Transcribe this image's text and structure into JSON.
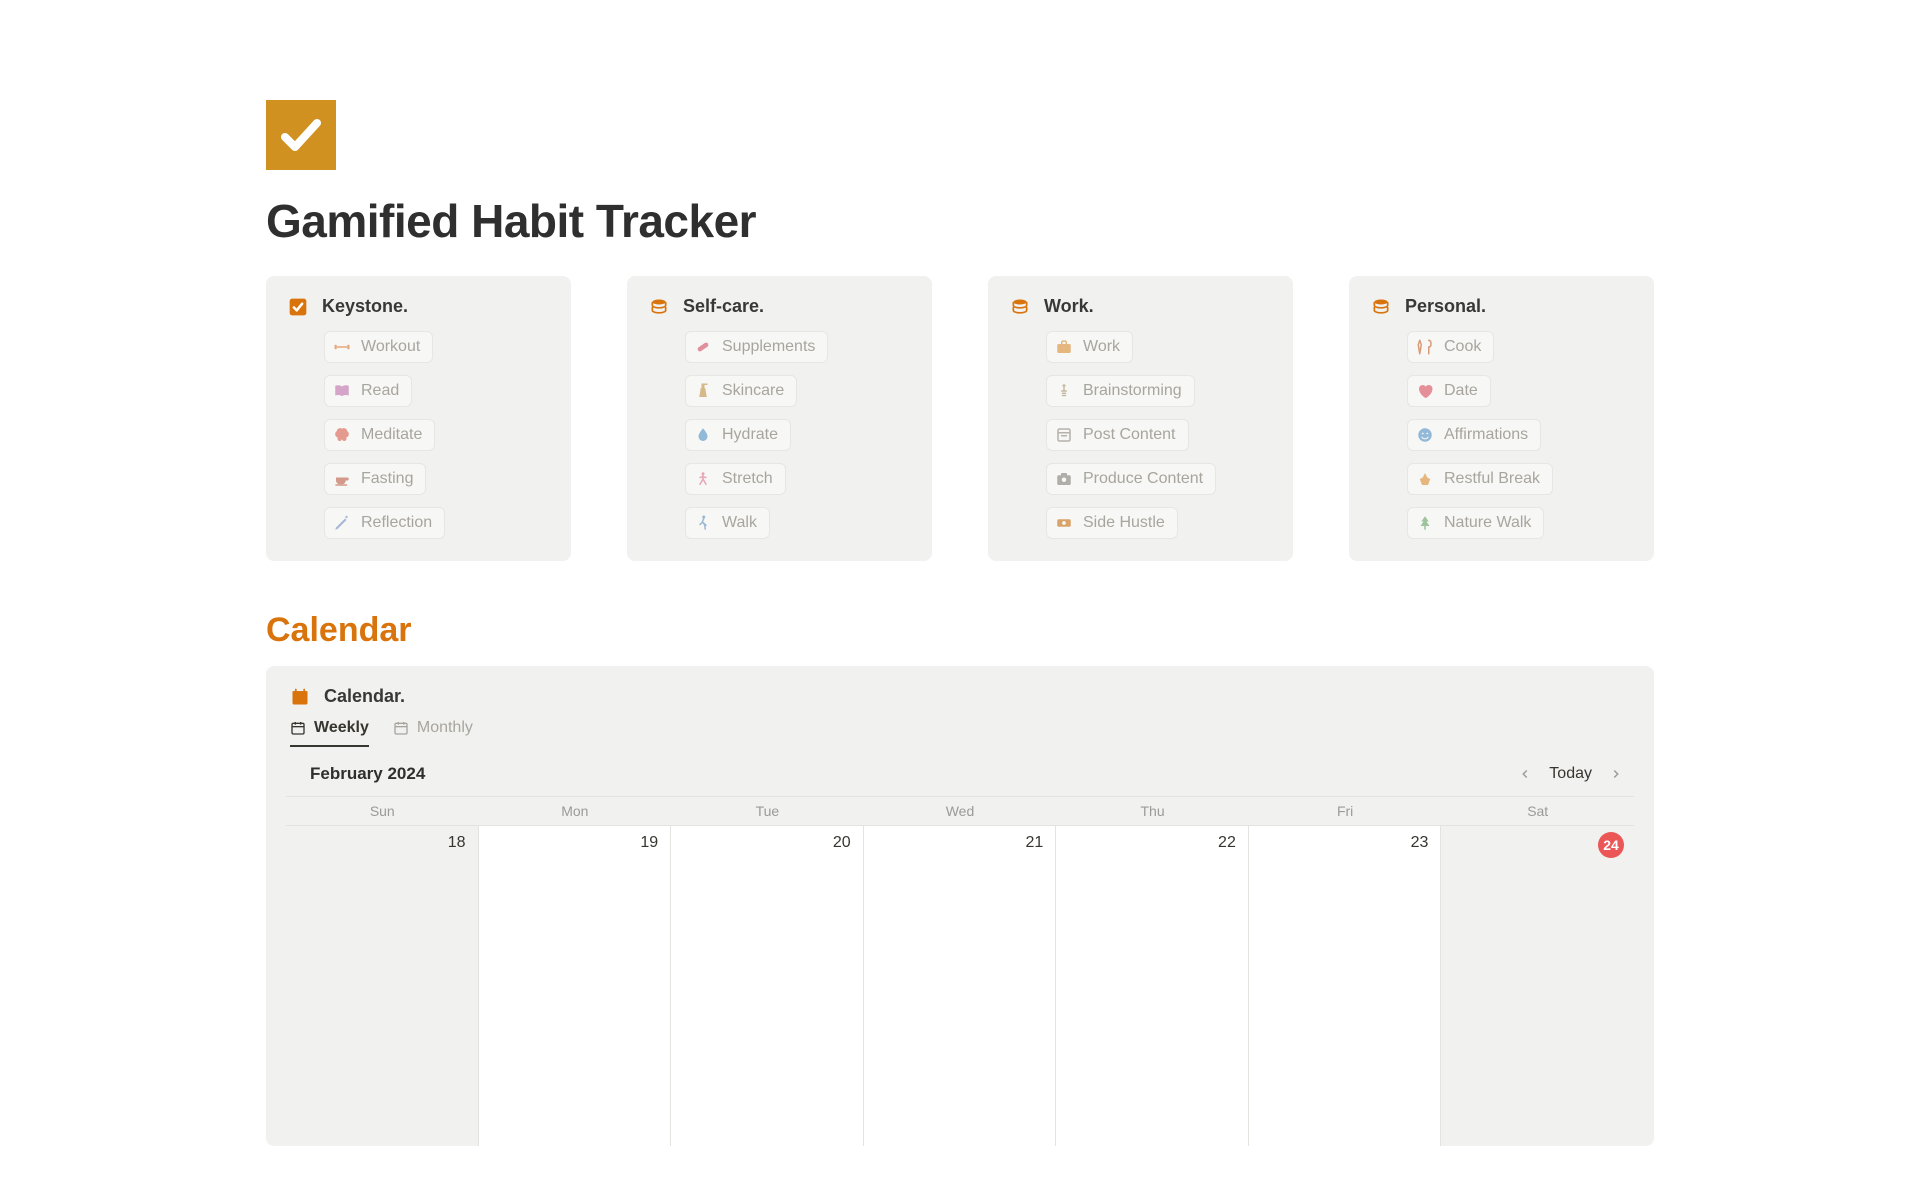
{
  "page": {
    "title": "Gamified Habit Tracker"
  },
  "cards": [
    {
      "icon": "checkbox-icon",
      "icon_color": "#d9740d",
      "title": "Keystone.",
      "items": [
        {
          "icon": "dumbbell-icon",
          "icon_color": "#e8a87c",
          "label": "Workout"
        },
        {
          "icon": "book-icon",
          "icon_color": "#d4a5c9",
          "label": "Read"
        },
        {
          "icon": "brain-icon",
          "icon_color": "#e59a8f",
          "label": "Meditate"
        },
        {
          "icon": "coffee-icon",
          "icon_color": "#d39a8a",
          "label": "Fasting"
        },
        {
          "icon": "pencil-icon",
          "icon_color": "#a7b7d6",
          "label": "Reflection"
        }
      ]
    },
    {
      "icon": "stack-icon",
      "icon_color": "#d9740d",
      "title": "Self-care.",
      "items": [
        {
          "icon": "pill-icon",
          "icon_color": "#e08f9b",
          "label": "Supplements"
        },
        {
          "icon": "lotion-icon",
          "icon_color": "#d6b98a",
          "label": "Skincare"
        },
        {
          "icon": "droplet-icon",
          "icon_color": "#93b9d9",
          "label": "Hydrate"
        },
        {
          "icon": "stretch-icon",
          "icon_color": "#e7a6b3",
          "label": "Stretch"
        },
        {
          "icon": "walk-icon",
          "icon_color": "#9bb7d4",
          "label": "Walk"
        }
      ]
    },
    {
      "icon": "stack-icon",
      "icon_color": "#d9740d",
      "title": "Work.",
      "items": [
        {
          "icon": "briefcase-icon",
          "icon_color": "#e5b77e",
          "label": "Work"
        },
        {
          "icon": "lightbulb-icon",
          "icon_color": "#c7b9a3",
          "label": "Brainstorming"
        },
        {
          "icon": "post-icon",
          "icon_color": "#b5b2ac",
          "label": "Post Content"
        },
        {
          "icon": "camera-icon",
          "icon_color": "#b0aea8",
          "label": "Produce Content"
        },
        {
          "icon": "money-icon",
          "icon_color": "#d9a36a",
          "label": "Side Hustle"
        }
      ]
    },
    {
      "icon": "stack-icon",
      "icon_color": "#d9740d",
      "title": "Personal.",
      "items": [
        {
          "icon": "utensil-icon",
          "icon_color": "#d99a7a",
          "label": "Cook"
        },
        {
          "icon": "heart-icon",
          "icon_color": "#e58f98",
          "label": "Date"
        },
        {
          "icon": "smile-icon",
          "icon_color": "#93b9d9",
          "label": "Affirmations"
        },
        {
          "icon": "praise-icon",
          "icon_color": "#e5b77e",
          "label": "Restful Break"
        },
        {
          "icon": "tree-icon",
          "icon_color": "#9ec49e",
          "label": "Nature Walk"
        }
      ]
    }
  ],
  "calendar_section_heading": "Calendar",
  "calendar": {
    "title": "Calendar.",
    "tabs": [
      {
        "label": "Weekly",
        "active": true
      },
      {
        "label": "Monthly",
        "active": false
      }
    ],
    "month_label": "February 2024",
    "today_label": "Today",
    "day_headers": [
      "Sun",
      "Mon",
      "Tue",
      "Wed",
      "Thu",
      "Fri",
      "Sat"
    ],
    "dates": [
      {
        "num": "18",
        "today": false
      },
      {
        "num": "19",
        "today": false
      },
      {
        "num": "20",
        "today": false
      },
      {
        "num": "21",
        "today": false
      },
      {
        "num": "22",
        "today": false
      },
      {
        "num": "23",
        "today": false
      },
      {
        "num": "24",
        "today": true
      }
    ]
  }
}
